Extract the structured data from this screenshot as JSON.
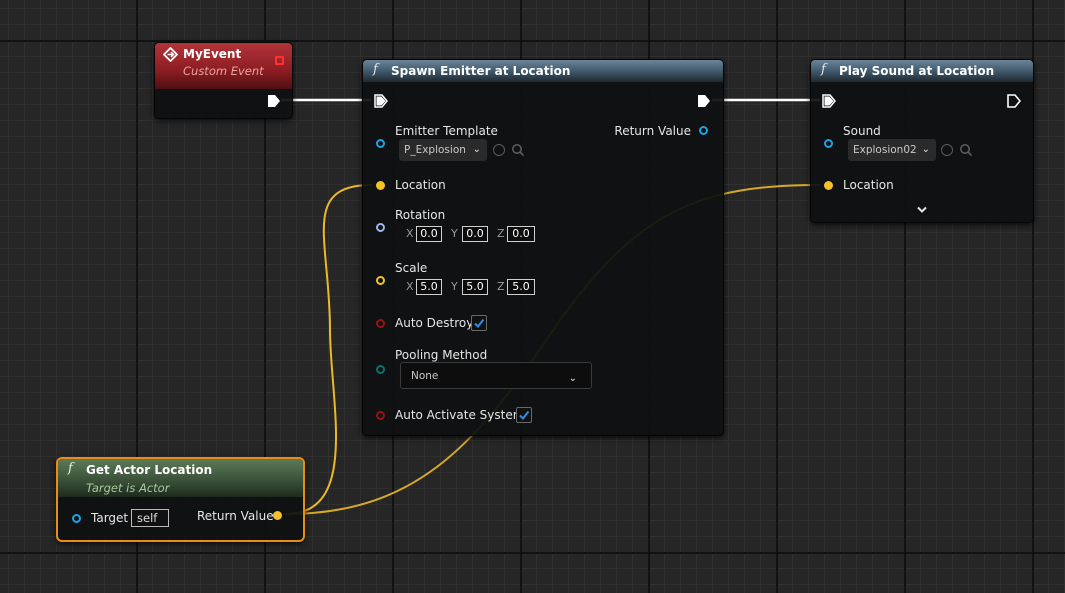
{
  "colors": {
    "exec": "#ffffff",
    "vector_pin": "#f5c028",
    "object_pin": "#1aa3e8",
    "rotator_pin": "#a0b4f0",
    "bool_pin": "#9b1010",
    "enum_pin": "#0e6e70",
    "selected_outline": "#e98e14"
  },
  "my_event": {
    "title": "MyEvent",
    "subtitle": "Custom Event",
    "icon": "diamond-event-icon"
  },
  "spawn_emitter": {
    "title": "Spawn Emitter at Location",
    "icon": "function-icon",
    "emitter_template_label": "Emitter Template",
    "emitter_template_value": "P_Explosion",
    "return_value_label": "Return Value",
    "location_label": "Location",
    "rotation_label": "Rotation",
    "rotation": {
      "x_label": "X",
      "x": "0.0",
      "y_label": "Y",
      "y": "0.0",
      "z_label": "Z",
      "z": "0.0"
    },
    "scale_label": "Scale",
    "scale": {
      "x_label": "X",
      "x": "5.0",
      "y_label": "Y",
      "y": "5.0",
      "z_label": "Z",
      "z": "5.0"
    },
    "auto_destroy_label": "Auto Destroy",
    "auto_destroy_checked": true,
    "pooling_method_label": "Pooling Method",
    "pooling_method_value": "None",
    "auto_activate_label": "Auto Activate System",
    "auto_activate_checked": true
  },
  "play_sound": {
    "title": "Play Sound at Location",
    "icon": "function-icon",
    "sound_label": "Sound",
    "sound_value": "Explosion02",
    "location_label": "Location"
  },
  "get_actor_location": {
    "title": "Get Actor Location",
    "subtitle": "Target is Actor",
    "icon": "function-icon",
    "target_label": "Target",
    "target_value": "self",
    "return_value_label": "Return Value"
  }
}
